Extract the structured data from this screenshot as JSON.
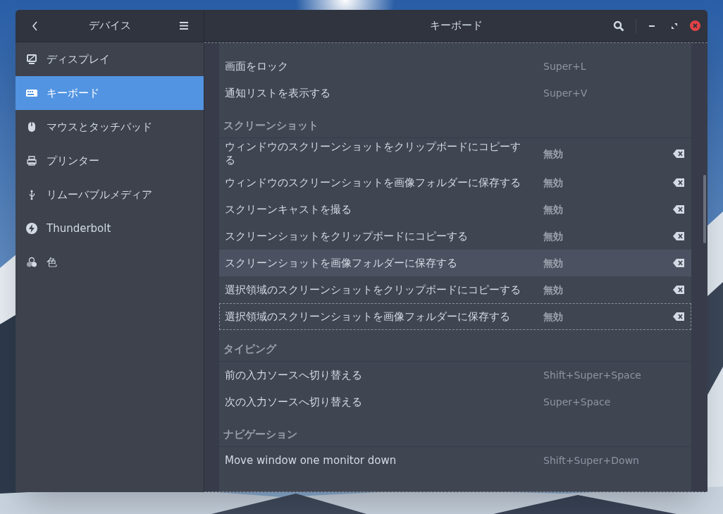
{
  "sidebar": {
    "title": "デバイス",
    "items": [
      {
        "label": "ディスプレイ",
        "selected": false
      },
      {
        "label": "キーボード",
        "selected": true
      },
      {
        "label": "マウスとタッチパッド",
        "selected": false
      },
      {
        "label": "プリンター",
        "selected": false
      },
      {
        "label": "リムーバブルメディア",
        "selected": false
      },
      {
        "label": "Thunderbolt",
        "selected": false
      },
      {
        "label": "色",
        "selected": false
      }
    ]
  },
  "window": {
    "title": "キーボード"
  },
  "sections": [
    {
      "rows": [
        {
          "action": "画面をロック",
          "shortcut": "Super+L",
          "unset": false,
          "hovered": false,
          "focused": false
        },
        {
          "action": "通知リストを表示する",
          "shortcut": "Super+V",
          "unset": false,
          "hovered": false,
          "focused": false
        }
      ]
    },
    {
      "title": "スクリーンショット",
      "rows": [
        {
          "action": "ウィンドウのスクリーンショットをクリップボードにコピーする",
          "shortcut": "無効",
          "unset": true,
          "hovered": false,
          "focused": false
        },
        {
          "action": "ウィンドウのスクリーンショットを画像フォルダーに保存する",
          "shortcut": "無効",
          "unset": true,
          "hovered": false,
          "focused": false
        },
        {
          "action": "スクリーンキャストを撮る",
          "shortcut": "無効",
          "unset": true,
          "hovered": false,
          "focused": false
        },
        {
          "action": "スクリーンショットをクリップボードにコピーする",
          "shortcut": "無効",
          "unset": true,
          "hovered": false,
          "focused": false
        },
        {
          "action": "スクリーンショットを画像フォルダーに保存する",
          "shortcut": "無効",
          "unset": true,
          "hovered": true,
          "focused": false
        },
        {
          "action": "選択領域のスクリーンショットをクリップボードにコピーする",
          "shortcut": "無効",
          "unset": true,
          "hovered": false,
          "focused": false
        },
        {
          "action": "選択領域のスクリーンショットを画像フォルダーに保存する",
          "shortcut": "無効",
          "unset": true,
          "hovered": false,
          "focused": true
        }
      ]
    },
    {
      "title": "タイピング",
      "rows": [
        {
          "action": "前の入力ソースへ切り替える",
          "shortcut": "Shift+Super+Space",
          "unset": false,
          "hovered": false,
          "focused": false
        },
        {
          "action": "次の入力ソースへ切り替える",
          "shortcut": "Super+Space",
          "unset": false,
          "hovered": false,
          "focused": false
        }
      ]
    },
    {
      "title": "ナビゲーション",
      "rows": [
        {
          "action": "Move window one monitor down",
          "shortcut": "Shift+Super+Down",
          "unset": false,
          "hovered": false,
          "focused": false
        }
      ]
    }
  ]
}
